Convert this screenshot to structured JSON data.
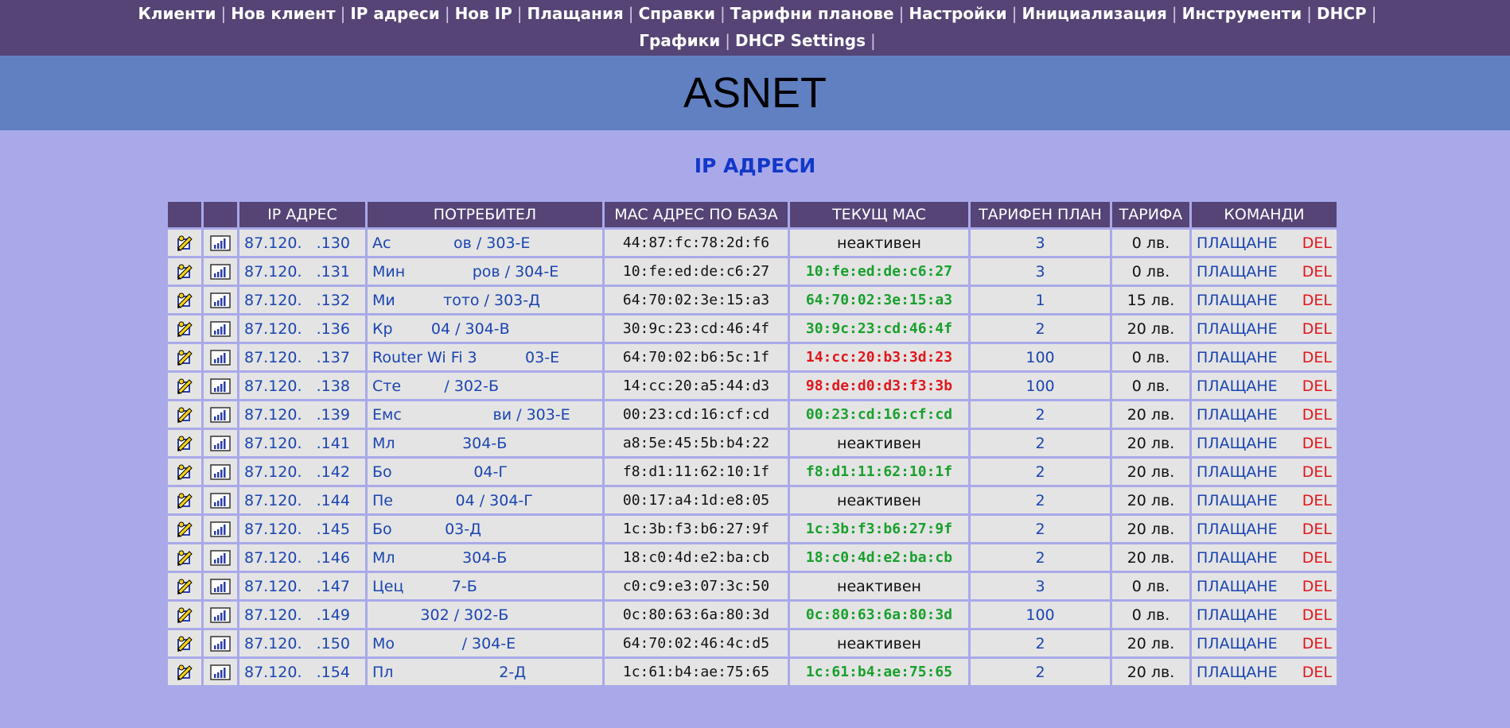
{
  "nav": {
    "row1": [
      "Клиенти",
      "Нов клиент",
      "IP адреси",
      "Нов IP",
      "Плащания",
      "Справки",
      "Тарифни планове",
      "Настройки",
      "Инициализация",
      "Инструменти",
      "DHCP"
    ],
    "row2": [
      "Графики",
      "DHCP Settings"
    ]
  },
  "banner": "ASNET",
  "page_title": "IP АДРЕСИ",
  "table": {
    "headers": [
      "",
      "",
      "IP АДРЕС",
      "ПОТРЕБИТЕЛ",
      "MAC АДРЕС ПО БАЗА",
      "ТЕКУЩ MAC",
      "ТАРИФЕН ПЛАН",
      "ТАРИФА",
      "КОМАНДИ"
    ],
    "pay_label": "ПЛАЩАНЕ",
    "del_label": "DEL",
    "rows": [
      {
        "ip": "87.120.   .130",
        "user": "Ас             ов / 303-Е",
        "mac": "44:87:fc:78:2d:f6",
        "cur": "неактивен",
        "status": "inactive",
        "plan": "3",
        "fee": "0 лв."
      },
      {
        "ip": "87.120.   .131",
        "user": "Мин              ров / 304-Е",
        "mac": "10:fe:ed:de:c6:27",
        "cur": "10:fe:ed:de:c6:27",
        "status": "green",
        "plan": "3",
        "fee": "0 лв."
      },
      {
        "ip": "87.120.   .132",
        "user": "Ми          тото / 303-Д",
        "mac": "64:70:02:3e:15:a3",
        "cur": "64:70:02:3e:15:a3",
        "status": "green",
        "plan": "1",
        "fee": "15 лв."
      },
      {
        "ip": "87.120.   .136",
        "user": "Кр        04 / 304-В",
        "mac": "30:9c:23:cd:46:4f",
        "cur": "30:9c:23:cd:46:4f",
        "status": "green",
        "plan": "2",
        "fee": "20 лв."
      },
      {
        "ip": "87.120.   .137",
        "user": "Router Wi Fi 3          03-Е",
        "mac": "64:70:02:b6:5c:1f",
        "cur": "14:cc:20:b3:3d:23",
        "status": "red",
        "plan": "100",
        "fee": "0 лв."
      },
      {
        "ip": "87.120.   .138",
        "user": "Сте         / 302-Б",
        "mac": "14:cc:20:a5:44:d3",
        "cur": "98:de:d0:d3:f3:3b",
        "status": "red",
        "plan": "100",
        "fee": "0 лв."
      },
      {
        "ip": "87.120.   .139",
        "user": "Емс                   ви / 303-Е",
        "mac": "00:23:cd:16:cf:cd",
        "cur": "00:23:cd:16:cf:cd",
        "status": "green",
        "plan": "2",
        "fee": "20 лв."
      },
      {
        "ip": "87.120.   .141",
        "user": "Мл              304-Б",
        "mac": "a8:5e:45:5b:b4:22",
        "cur": "неактивен",
        "status": "inactive",
        "plan": "2",
        "fee": "20 лв."
      },
      {
        "ip": "87.120.   .142",
        "user": "Бо                 04-Г",
        "mac": "f8:d1:11:62:10:1f",
        "cur": "f8:d1:11:62:10:1f",
        "status": "green",
        "plan": "2",
        "fee": "20 лв."
      },
      {
        "ip": "87.120.   .144",
        "user": "Пе             04 / 304-Г",
        "mac": "00:17:a4:1d:e8:05",
        "cur": "неактивен",
        "status": "inactive",
        "plan": "2",
        "fee": "20 лв."
      },
      {
        "ip": "87.120.   .145",
        "user": "Бо           03-Д",
        "mac": "1c:3b:f3:b6:27:9f",
        "cur": "1c:3b:f3:b6:27:9f",
        "status": "green",
        "plan": "2",
        "fee": "20 лв."
      },
      {
        "ip": "87.120.   .146",
        "user": "Мл              304-Б",
        "mac": "18:c0:4d:e2:ba:cb",
        "cur": "18:c0:4d:e2:ba:cb",
        "status": "green",
        "plan": "2",
        "fee": "20 лв."
      },
      {
        "ip": "87.120.   .147",
        "user": "Цец          7-Б",
        "mac": "c0:c9:e3:07:3c:50",
        "cur": "неактивен",
        "status": "inactive",
        "plan": "3",
        "fee": "0 лв."
      },
      {
        "ip": "87.120.   .149",
        "user": "          302 / 302-Б",
        "mac": "0c:80:63:6a:80:3d",
        "cur": "0c:80:63:6a:80:3d",
        "status": "green",
        "plan": "100",
        "fee": "0 лв."
      },
      {
        "ip": "87.120.   .150",
        "user": "Мо              / 304-Е",
        "mac": "64:70:02:46:4c:d5",
        "cur": "неактивен",
        "status": "inactive",
        "plan": "2",
        "fee": "20 лв."
      },
      {
        "ip": "87.120.   .154",
        "user": "Пл                      2-Д",
        "mac": "1c:61:b4:ae:75:65",
        "cur": "1c:61:b4:ae:75:65",
        "status": "green",
        "plan": "2",
        "fee": "20 лв."
      }
    ]
  }
}
